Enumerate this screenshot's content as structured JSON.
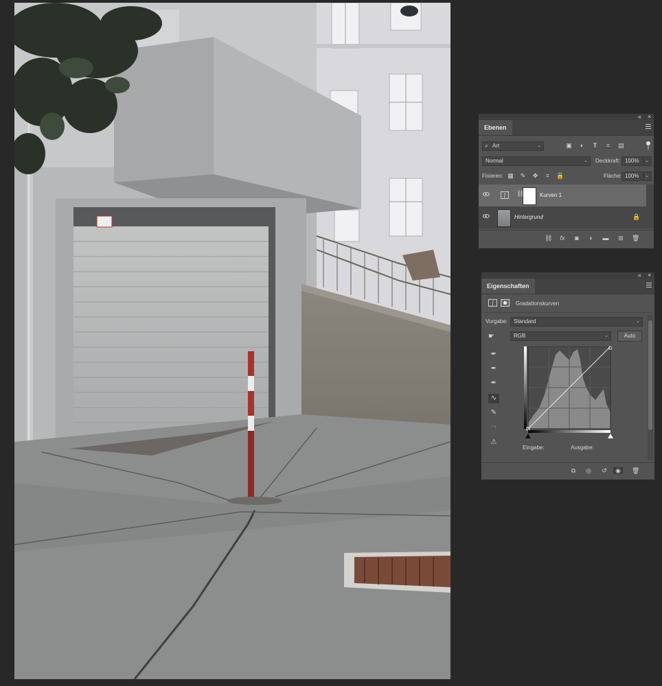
{
  "layers_panel": {
    "tab": "Ebenen",
    "filter_kind": "Art",
    "blend_mode": "Normal",
    "opacity_label": "Deckkraft:",
    "opacity_value": "100%",
    "lock_label": "Fixieren:",
    "fill_label": "Fläche:",
    "fill_value": "100%",
    "layers": [
      {
        "name": "Kurven 1",
        "selected": true
      },
      {
        "name": "Hintergrund",
        "selected": false
      }
    ]
  },
  "properties_panel": {
    "tab": "Eigenschaften",
    "header": "Gradationskurven",
    "preset_label": "Vorgabe:",
    "preset_value": "Standard",
    "channel_value": "RGB",
    "auto_label": "Auto",
    "input_label": "Eingabe:",
    "output_label": "Ausgabe:"
  },
  "colors": {
    "panel_bg": "#535353",
    "app_bg": "#282828",
    "selected_row": "#696969"
  }
}
